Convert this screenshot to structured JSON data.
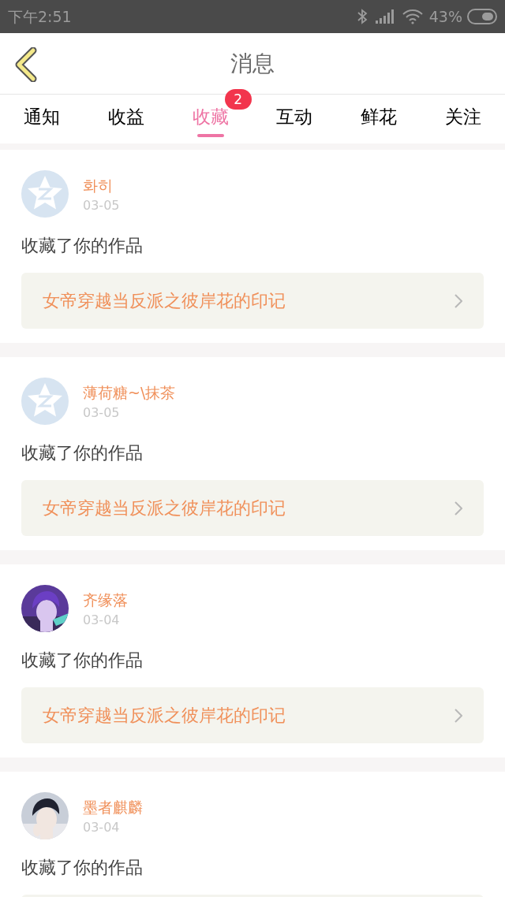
{
  "status_bar": {
    "time": "下午2:51",
    "battery": "43%"
  },
  "header": {
    "title": "消息"
  },
  "tabs": [
    {
      "label": "通知",
      "selected": false
    },
    {
      "label": "收益",
      "selected": false
    },
    {
      "label": "收藏",
      "selected": true,
      "badge": "2"
    },
    {
      "label": "互动",
      "selected": false
    },
    {
      "label": "鲜花",
      "selected": false
    },
    {
      "label": "关注",
      "selected": false
    }
  ],
  "messages": [
    {
      "avatar": {
        "kind": "default"
      },
      "name": "화히",
      "date": "03-05",
      "text": "收藏了你的作品",
      "work": "女帝穿越当反派之彼岸花的印记"
    },
    {
      "avatar": {
        "kind": "default"
      },
      "name": "薄荷糖~\\抹茶",
      "date": "03-05",
      "text": "收藏了你的作品",
      "work": "女帝穿越当反派之彼岸花的印记"
    },
    {
      "name": "齐缘落",
      "date": "03-04",
      "text": "收藏了你的作品",
      "work": "女帝穿越当反派之彼岸花的印记"
    },
    {
      "name": "墨者麒麟",
      "date": "03-04",
      "text": "收藏了你的作品"
    }
  ]
}
